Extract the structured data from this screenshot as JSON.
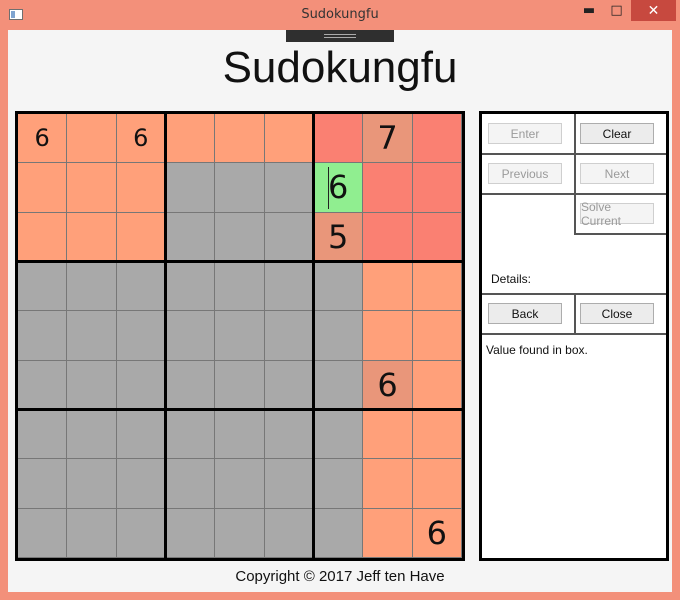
{
  "window": {
    "title": "Sudokungfu",
    "minimize_glyph": "▬",
    "maximize_glyph": "□",
    "close_glyph": "✕"
  },
  "heading": "Sudokungfu",
  "colors": {
    "orange": "#ffa07a",
    "gray": "#a9a9a9",
    "red": "#fa8072",
    "dark_orange": "#e9967a",
    "green": "#90ee90"
  },
  "board": {
    "cells": [
      [
        {
          "v": "6",
          "c": "orange"
        },
        {
          "v": "",
          "c": "orange"
        },
        {
          "v": "6",
          "c": "orange"
        },
        {
          "v": "",
          "c": "orange"
        },
        {
          "v": "",
          "c": "orange"
        },
        {
          "v": "",
          "c": "orange"
        },
        {
          "v": "",
          "c": "red"
        },
        {
          "v": "7",
          "c": "dark_orange",
          "big": true
        },
        {
          "v": "",
          "c": "red"
        }
      ],
      [
        {
          "v": "",
          "c": "orange"
        },
        {
          "v": "",
          "c": "orange"
        },
        {
          "v": "",
          "c": "orange"
        },
        {
          "v": "",
          "c": "gray"
        },
        {
          "v": "",
          "c": "gray"
        },
        {
          "v": "",
          "c": "gray"
        },
        {
          "v": "6",
          "c": "green",
          "big": true,
          "cursor": true
        },
        {
          "v": "",
          "c": "red"
        },
        {
          "v": "",
          "c": "red"
        }
      ],
      [
        {
          "v": "",
          "c": "orange"
        },
        {
          "v": "",
          "c": "orange"
        },
        {
          "v": "",
          "c": "orange"
        },
        {
          "v": "",
          "c": "gray"
        },
        {
          "v": "",
          "c": "gray"
        },
        {
          "v": "",
          "c": "gray"
        },
        {
          "v": "5",
          "c": "dark_orange",
          "big": true
        },
        {
          "v": "",
          "c": "red"
        },
        {
          "v": "",
          "c": "red"
        }
      ],
      [
        {
          "v": "",
          "c": "gray"
        },
        {
          "v": "",
          "c": "gray"
        },
        {
          "v": "",
          "c": "gray"
        },
        {
          "v": "",
          "c": "gray"
        },
        {
          "v": "",
          "c": "gray"
        },
        {
          "v": "",
          "c": "gray"
        },
        {
          "v": "",
          "c": "gray"
        },
        {
          "v": "",
          "c": "orange"
        },
        {
          "v": "",
          "c": "orange"
        }
      ],
      [
        {
          "v": "",
          "c": "gray"
        },
        {
          "v": "",
          "c": "gray"
        },
        {
          "v": "",
          "c": "gray"
        },
        {
          "v": "",
          "c": "gray"
        },
        {
          "v": "",
          "c": "gray"
        },
        {
          "v": "",
          "c": "gray"
        },
        {
          "v": "",
          "c": "gray"
        },
        {
          "v": "",
          "c": "orange"
        },
        {
          "v": "",
          "c": "orange"
        }
      ],
      [
        {
          "v": "",
          "c": "gray"
        },
        {
          "v": "",
          "c": "gray"
        },
        {
          "v": "",
          "c": "gray"
        },
        {
          "v": "",
          "c": "gray"
        },
        {
          "v": "",
          "c": "gray"
        },
        {
          "v": "",
          "c": "gray"
        },
        {
          "v": "",
          "c": "gray"
        },
        {
          "v": "6",
          "c": "dark_orange",
          "big": true
        },
        {
          "v": "",
          "c": "orange"
        }
      ],
      [
        {
          "v": "",
          "c": "gray"
        },
        {
          "v": "",
          "c": "gray"
        },
        {
          "v": "",
          "c": "gray"
        },
        {
          "v": "",
          "c": "gray"
        },
        {
          "v": "",
          "c": "gray"
        },
        {
          "v": "",
          "c": "gray"
        },
        {
          "v": "",
          "c": "gray"
        },
        {
          "v": "",
          "c": "orange"
        },
        {
          "v": "",
          "c": "orange"
        }
      ],
      [
        {
          "v": "",
          "c": "gray"
        },
        {
          "v": "",
          "c": "gray"
        },
        {
          "v": "",
          "c": "gray"
        },
        {
          "v": "",
          "c": "gray"
        },
        {
          "v": "",
          "c": "gray"
        },
        {
          "v": "",
          "c": "gray"
        },
        {
          "v": "",
          "c": "gray"
        },
        {
          "v": "",
          "c": "orange"
        },
        {
          "v": "",
          "c": "orange"
        }
      ],
      [
        {
          "v": "",
          "c": "gray"
        },
        {
          "v": "",
          "c": "gray"
        },
        {
          "v": "",
          "c": "gray"
        },
        {
          "v": "",
          "c": "gray"
        },
        {
          "v": "",
          "c": "gray"
        },
        {
          "v": "",
          "c": "gray"
        },
        {
          "v": "",
          "c": "gray"
        },
        {
          "v": "",
          "c": "orange"
        },
        {
          "v": "6",
          "c": "orange",
          "big": true
        }
      ]
    ]
  },
  "panel": {
    "enter": "Enter",
    "clear": "Clear",
    "previous": "Previous",
    "next": "Next",
    "solve_current": "Solve Current",
    "details_label": "Details:",
    "back": "Back",
    "close": "Close",
    "message": "Value found in box."
  },
  "footer": "Copyright © 2017 Jeff ten Have"
}
